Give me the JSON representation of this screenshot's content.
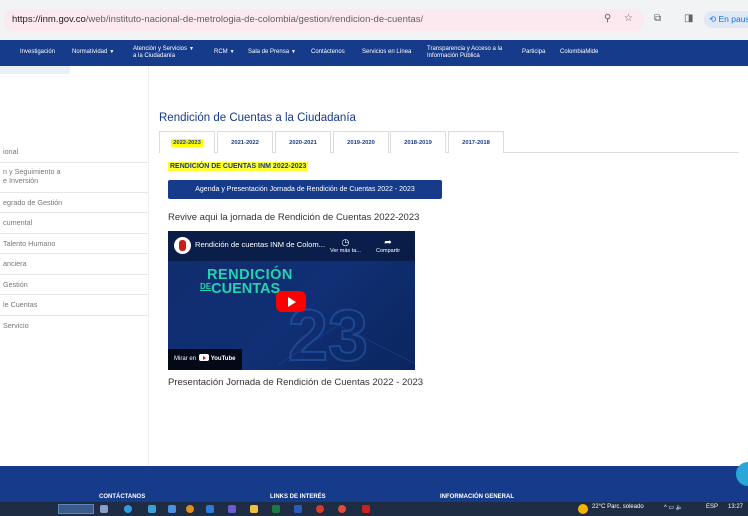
{
  "browser": {
    "url_host": "https://inm.gov.co",
    "url_path": "/web/instituto-nacional-de-metrologia-de-colombia/gestion/rendicion-de-cuentas/",
    "paused_label": "En pausa"
  },
  "nav": [
    {
      "label": "Investigación",
      "caret": false
    },
    {
      "label": "Normatividad",
      "caret": true
    },
    {
      "label": "Atención y Servicios",
      "label2": "a la Ciudadanía",
      "caret": true
    },
    {
      "label": "RCM",
      "caret": true
    },
    {
      "label": "Sala de Prensa",
      "caret": true
    },
    {
      "label": "Contáctenos",
      "caret": false
    },
    {
      "label": "Servicios en Línea",
      "caret": false
    },
    {
      "label": "Transparencia y Acceso a la",
      "label2": "Información Pública",
      "caret": false
    },
    {
      "label": "Participa",
      "caret": false
    },
    {
      "label": "ColombiaMide",
      "caret": false
    }
  ],
  "sidebar": {
    "items": [
      "ional",
      "n y Seguimiento a",
      "e Inversión",
      "egrado de Gestión",
      "cumental",
      "Talento Humano",
      "anciera",
      "Gestión",
      "le Cuentas",
      "Servicio"
    ]
  },
  "main": {
    "title": "Rendición de Cuentas a la Ciudadanía",
    "tabs": [
      "2022-2023",
      "2021-2022",
      "2020-2021",
      "2019-2020",
      "2018-2019",
      "2017-2018"
    ],
    "active_tab": "2022-2023",
    "section_label": "RENDICIÓN DE CUENTAS INM 2022-2023",
    "agenda_button": "Agenda y Presentación Jornada de Rendición de Cuentas 2022 - 2023",
    "revive_text": "Revive aqui la jornada de Rendición de Cuentas 2022-2023",
    "video": {
      "title": "Rendición de cuentas INM de Colom...",
      "watch_later": "Ver más ta...",
      "share": "Compartir",
      "headline_1": "RENDICIÓN",
      "headline_de": "DE",
      "headline_2": "CUENTAS",
      "watch_on": "Mirar en",
      "youtube": "YouTube"
    },
    "presentation_text": "Presentación Jornada de Rendición de Cuentas 2022 - 2023"
  },
  "footer": {
    "contact": "CONTÁCTANOS",
    "links": "LINKS DE INTERÉS",
    "info": "INFORMACIÓN GENERAL"
  },
  "taskbar": {
    "weather": "22°C  Parc. soleado",
    "lang": "ESP",
    "time": "13:27"
  },
  "colors": {
    "brand_blue": "#163b8a",
    "highlight": "#ffff00",
    "video_accent": "#26d3ae"
  }
}
